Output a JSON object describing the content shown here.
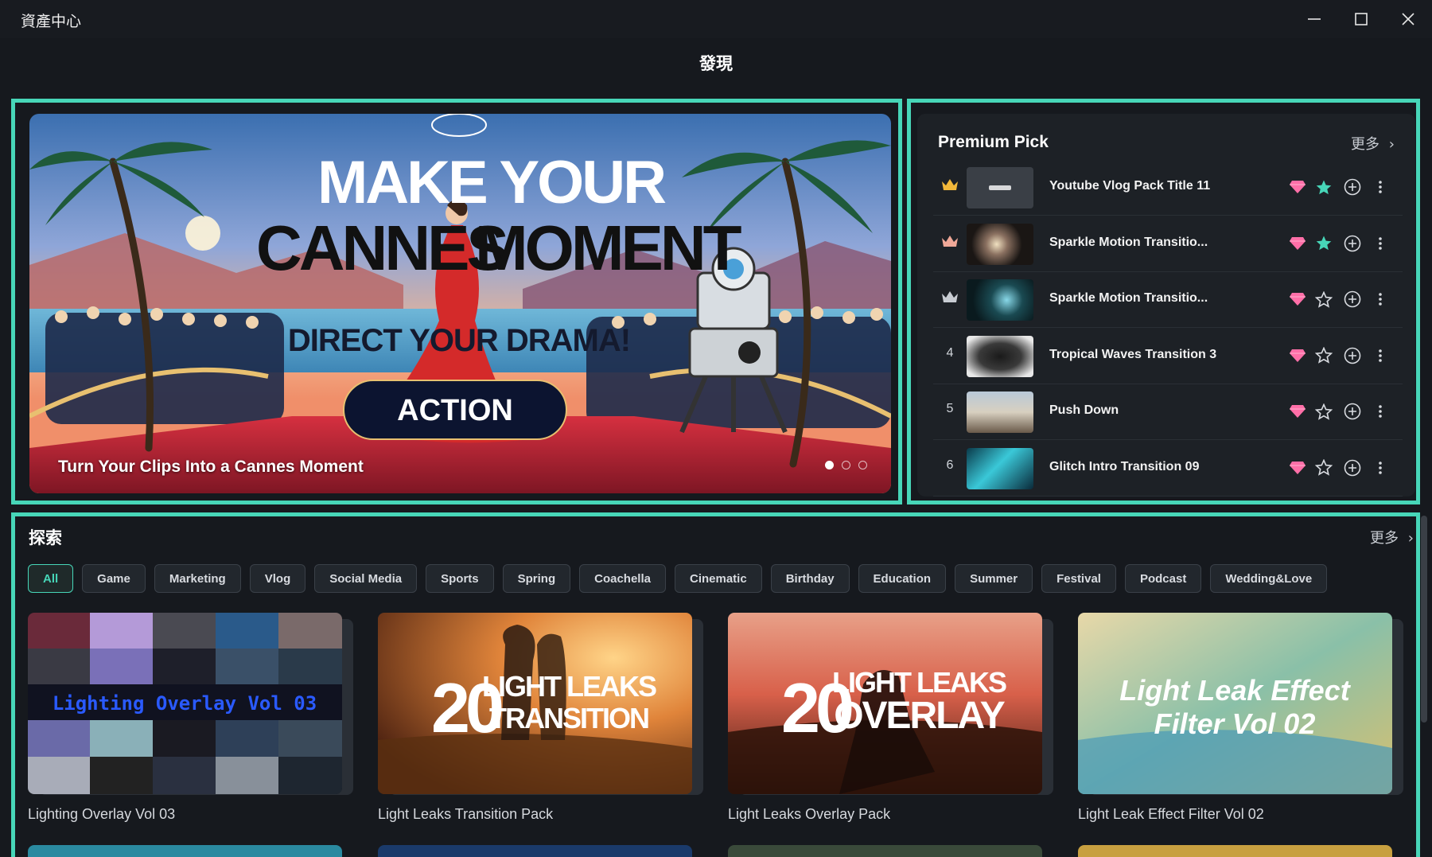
{
  "window": {
    "title": "資產中心",
    "controls": [
      "minimize",
      "maximize",
      "close"
    ]
  },
  "page": {
    "heading": "發現"
  },
  "banner": {
    "art": {
      "line1": "MAKE YOUR",
      "line2a": "CANNES",
      "line2b": "MOMENT",
      "tagline": "DIRECT YOUR DRAMA!",
      "button": "ACTION"
    },
    "caption": "Turn Your Clips Into a Cannes Moment",
    "slides": {
      "count": 3,
      "active": 1
    }
  },
  "premium_pick": {
    "title": "Premium Pick",
    "more_label": "更多",
    "items": [
      {
        "rank": "1",
        "rank_icon": "crown-gold-icon",
        "name": "Youtube Vlog Pack Title 11",
        "favorited": true
      },
      {
        "rank": "2",
        "rank_icon": "crown-silver-icon",
        "name": "Sparkle Motion Transitio...",
        "favorited": true
      },
      {
        "rank": "3",
        "rank_icon": "crown-bronze-icon",
        "name": "Sparkle Motion Transitio...",
        "favorited": false
      },
      {
        "rank": "4",
        "rank_icon": "",
        "name": "Tropical Waves Transition 3",
        "favorited": false
      },
      {
        "rank": "5",
        "rank_icon": "",
        "name": "Push Down",
        "favorited": false
      },
      {
        "rank": "6",
        "rank_icon": "",
        "name": "Glitch Intro Transition 09",
        "favorited": false
      }
    ]
  },
  "explore": {
    "title": "探索",
    "more_label": "更多",
    "filters": [
      "All",
      "Game",
      "Marketing",
      "Vlog",
      "Social Media",
      "Sports",
      "Spring",
      "Coachella",
      "Cinematic",
      "Birthday",
      "Education",
      "Summer",
      "Festival",
      "Podcast",
      "Wedding&Love"
    ],
    "active_filter": "All",
    "cards": [
      {
        "title": "Lighting Overlay Vol 03",
        "art_text": "Lighting Overlay Vol 03"
      },
      {
        "title": "Light Leaks Transition Pack",
        "art_num": "20",
        "art_l1": "LIGHT LEAKS",
        "art_l2": "TRANSITION"
      },
      {
        "title": "Light Leaks Overlay Pack",
        "art_num": "20",
        "art_l1": "LIGHT LEAKS",
        "art_l2": "OVERLAY"
      },
      {
        "title": "Light Leak Effect Filter Vol 02",
        "art_l1": "Light Leak Effect",
        "art_l2": "Filter Vol 02"
      }
    ]
  },
  "colors": {
    "accent": "#47d6b8",
    "background": "#16191e",
    "panel": "#1d2126",
    "gem": "#ff6fa8"
  }
}
